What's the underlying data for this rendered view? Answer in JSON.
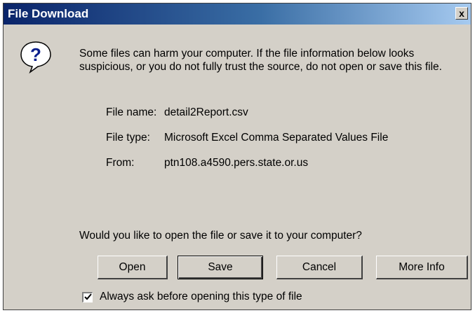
{
  "window": {
    "title": "File Download",
    "close_label": "x"
  },
  "icons": {
    "question": "question-mark-icon"
  },
  "warning_text": "Some files can harm your computer. If the file information below looks suspicious, or you do not fully trust the source, do not open or save this file.",
  "file_info": {
    "name_label": "File name:",
    "name_value": "detail2Report.csv",
    "type_label": "File type:",
    "type_value": "Microsoft Excel Comma Separated Values File",
    "from_label": "From:",
    "from_value": "ptn108.a4590.pers.state.or.us"
  },
  "question_text": "Would you like to open the file or save it to your computer?",
  "buttons": {
    "open": "Open",
    "save": "Save",
    "cancel": "Cancel",
    "more_info": "More Info"
  },
  "always_ask": {
    "label": "Always ask before opening this type of file",
    "checked": true
  },
  "colors": {
    "titlebar_start": "#0a246a",
    "titlebar_end": "#a6caf0",
    "dialog_bg": "#d4d0c8"
  }
}
